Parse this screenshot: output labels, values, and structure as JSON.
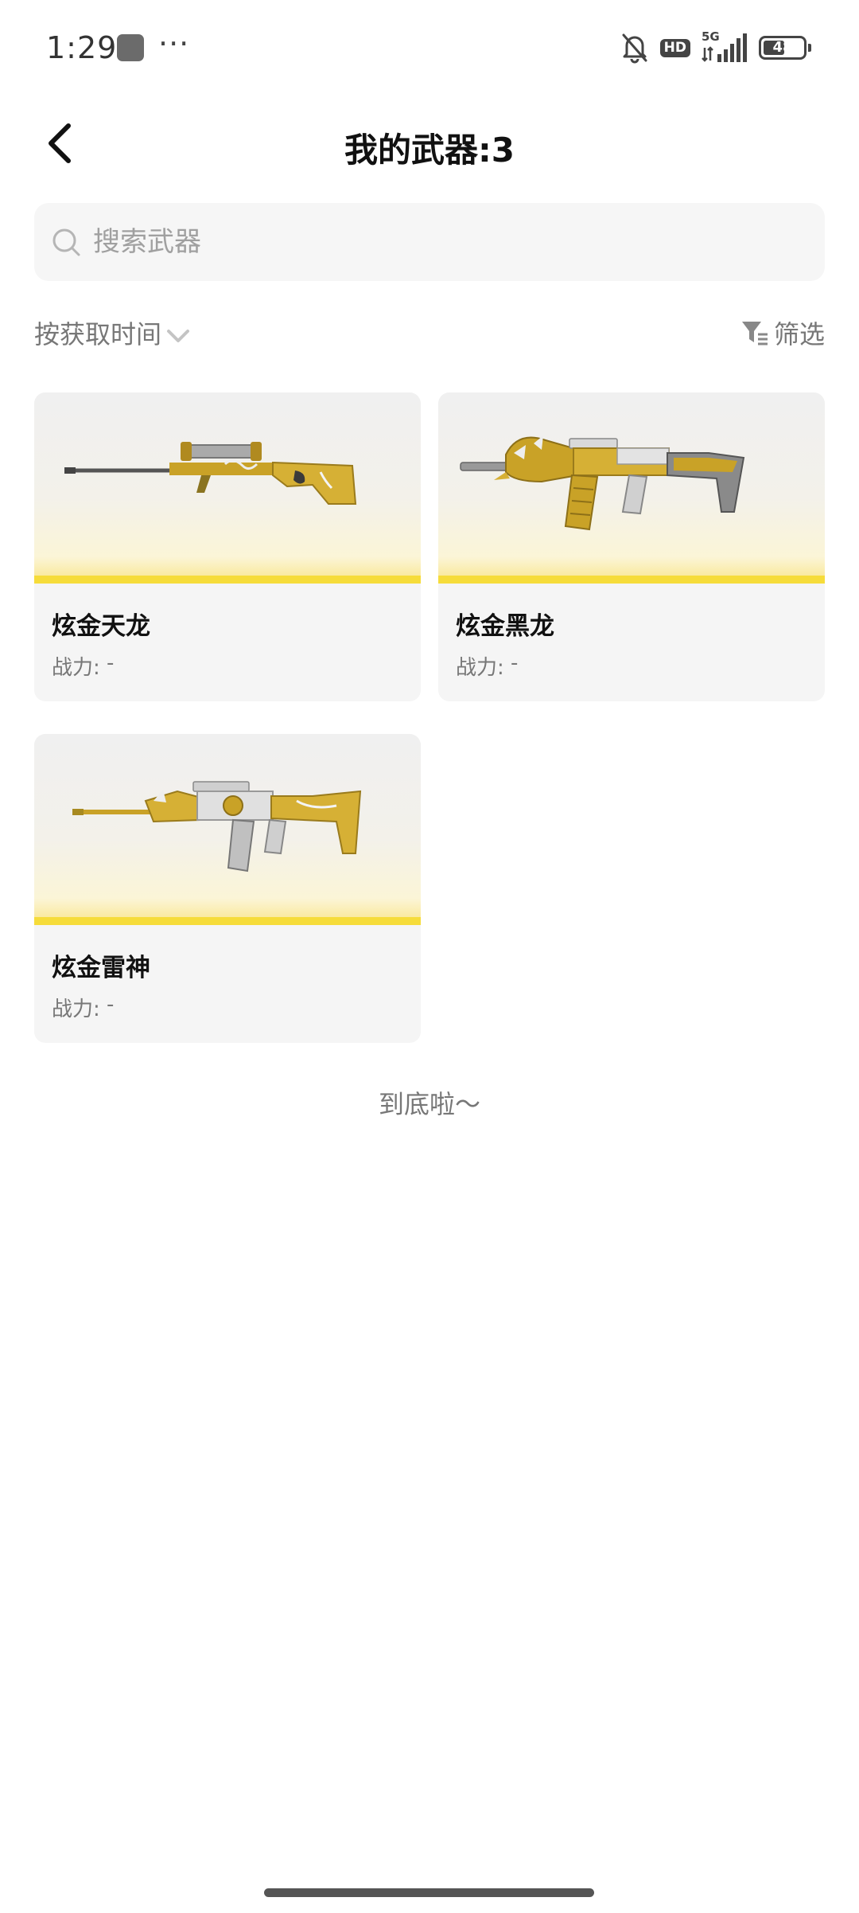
{
  "status_bar": {
    "time": "1:29",
    "more": "···",
    "hd_label": "HD",
    "network_label": "5G",
    "battery": "48"
  },
  "header": {
    "title": "我的武器:3"
  },
  "search": {
    "placeholder": "搜索武器"
  },
  "sort": {
    "label": "按获取时间"
  },
  "filter": {
    "label": "筛选"
  },
  "weapons": [
    {
      "name": "炫金天龙",
      "power_label": "战力:",
      "power_value": " -",
      "type": "sniper-rifle"
    },
    {
      "name": "炫金黑龙",
      "power_label": "战力:",
      "power_value": " -",
      "type": "assault-rifle"
    },
    {
      "name": "炫金雷神",
      "power_label": "战力:",
      "power_value": " -",
      "type": "assault-rifle"
    }
  ],
  "footer": {
    "end_text": "到底啦～"
  },
  "colors": {
    "accent_yellow": "#f6dc3a",
    "gold": "#c9a227",
    "card_bg": "#f5f5f5",
    "search_bg": "#f6f6f6",
    "muted_text": "#777777"
  }
}
